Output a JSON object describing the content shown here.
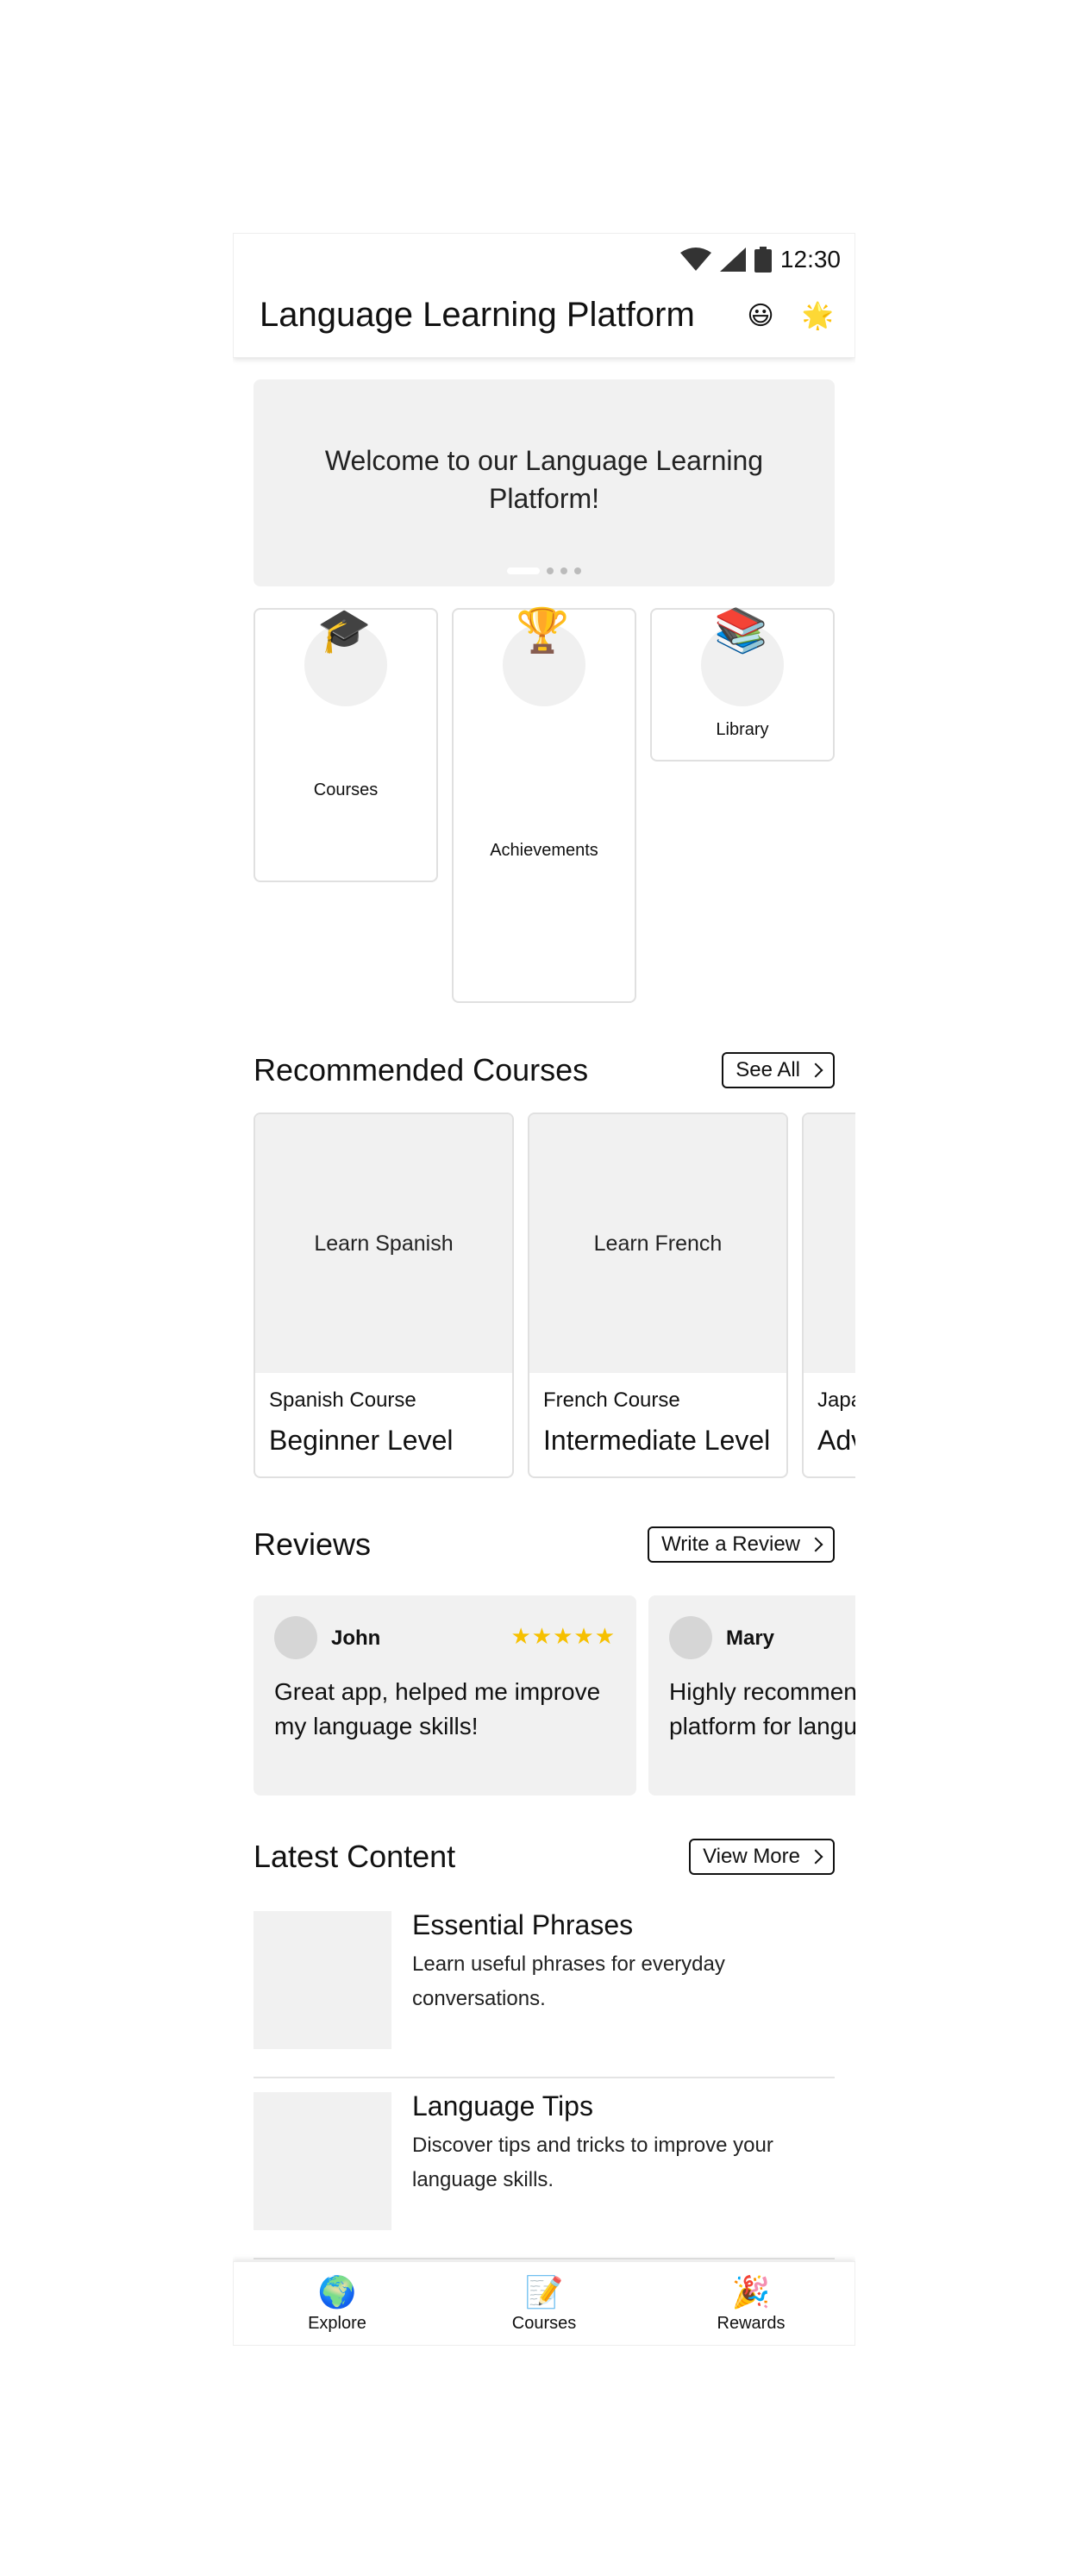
{
  "status_bar": {
    "time": "12:30",
    "icons": [
      "wifi-icon",
      "signal-icon",
      "battery-icon"
    ]
  },
  "app_bar": {
    "title": "Language Learning Platform",
    "icon_left": "😃",
    "icon_right": "🌟"
  },
  "carousel": {
    "text": "Welcome to our Language Learning Platform!",
    "slide_count": 4,
    "active_slide": 1
  },
  "quick_tiles": [
    {
      "label": "Courses",
      "emoji": "🎓"
    },
    {
      "label": "Achievements",
      "emoji": "🏆"
    },
    {
      "label": "Library",
      "emoji": "📚"
    }
  ],
  "recommended": {
    "title": "Recommended Courses",
    "button": "See All",
    "courses": [
      {
        "image_text": "Learn Spanish",
        "subtitle": "Spanish Course",
        "level": "Beginner Level"
      },
      {
        "image_text": "Learn French",
        "subtitle": "French Course",
        "level": "Intermediate Level"
      },
      {
        "image_text": "",
        "subtitle": "Japa",
        "level": "Adv"
      }
    ]
  },
  "reviews": {
    "title": "Reviews",
    "button": "Write a Review",
    "items": [
      {
        "name": "John",
        "stars": "★★★★★",
        "text": "Great app, helped me improve my language skills!"
      },
      {
        "name": "Mary",
        "stars": "★★★★★",
        "text": "Highly recommen platform for langu"
      }
    ]
  },
  "latest": {
    "title": "Latest Content",
    "button": "View More",
    "items": [
      {
        "title": "Essential Phrases",
        "desc": "Learn useful phrases for everyday conversations."
      },
      {
        "title": "Language Tips",
        "desc": "Discover tips and tricks to improve your language skills."
      }
    ]
  },
  "bottom_nav": [
    {
      "label": "Explore",
      "emoji": "🌍"
    },
    {
      "label": "Courses",
      "emoji": "📝"
    },
    {
      "label": "Rewards",
      "emoji": "🎉"
    }
  ],
  "colors": {
    "star": "#f6c000",
    "card_bg": "#f1f1f1",
    "border": "#e0e0e0"
  }
}
